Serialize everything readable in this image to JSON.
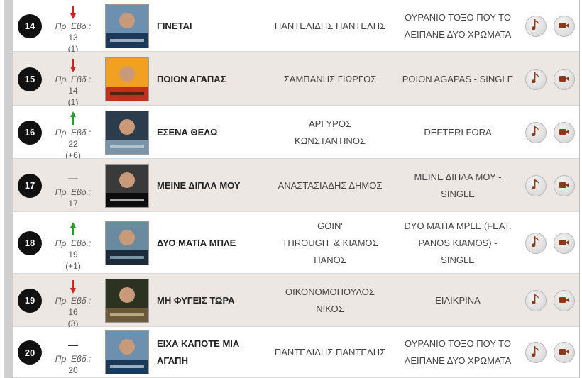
{
  "colors": {
    "up": "#2a9a2a",
    "down": "#d02020",
    "position_bg": "#111111",
    "row_alt": "#ede7e3",
    "action_icon": "#8a3a18"
  },
  "labels": {
    "prev_week": "Πρ. Εβδ.:",
    "same": "—"
  },
  "icons": {
    "listen": "music-note-icon",
    "video": "video-camera-icon"
  },
  "rows": [
    {
      "position": "14",
      "trend": "down",
      "prev_week": "13",
      "delta": "(1)",
      "title": [
        "ΓΙΝΕΤΑΙ"
      ],
      "artist": [
        "ΠΑΝΤΕΛΙΔΗΣ ΠΑΝΤΕΛΗΣ"
      ],
      "album": [
        "ΟΥΡΑΝΙΟ ΤΟΞΟ ΠΟΥ ΤΟ",
        "ΛΕΙΠΑΝΕ ΔΥΟ ΧΡΩΜΑΤΑ"
      ]
    },
    {
      "position": "15",
      "trend": "down",
      "prev_week": "14",
      "delta": "(1)",
      "title": [
        "ΠΟΙΟΝ ΑΓΑΠΑΣ"
      ],
      "artist": [
        "ΣΑΜΠΑΝΗΣ ΓΙΩΡΓΟΣ"
      ],
      "album": [
        "POION AGAPAS - SINGLE"
      ]
    },
    {
      "position": "16",
      "trend": "up",
      "prev_week": "22",
      "delta": "(+6)",
      "title": [
        "ΕΣΕΝΑ ΘΕΛΩ"
      ],
      "artist": [
        "ΑΡΓΥΡΟΣ",
        "ΚΩΝΣΤΑΝΤΙΝΟΣ"
      ],
      "album": [
        "DEFTERI FORA"
      ]
    },
    {
      "position": "17",
      "trend": "same",
      "prev_week": "17",
      "delta": "",
      "title": [
        "ΜΕΙΝΕ ΔΙΠΛΑ ΜΟΥ"
      ],
      "artist": [
        "ΑΝΑΣΤΑΣΙΑΔΗΣ ΔΗΜΟΣ"
      ],
      "album": [
        "ΜΕΙΝΕ ΔΙΠΛΑ ΜΟΥ -",
        "SINGLE"
      ]
    },
    {
      "position": "18",
      "trend": "up",
      "prev_week": "19",
      "delta": "(+1)",
      "title": [
        "ΔΥΟ ΜΑΤΙΑ ΜΠΛΕ"
      ],
      "artist": [
        "GOIN'",
        "THROUGH  & ΚΙΑΜΟΣ",
        "ΠΑΝΟΣ"
      ],
      "album": [
        "DYO MATIA MPLE (FEAT.",
        "PANOS KIAMOS) -",
        "SINGLE"
      ]
    },
    {
      "position": "19",
      "trend": "down",
      "prev_week": "16",
      "delta": "(3)",
      "title": [
        "ΜΗ ΦΥΓΕΙΣ ΤΩΡΑ"
      ],
      "artist": [
        "ΟΙΚΟΝΟΜΟΠΟΥΛΟΣ",
        "ΝΙΚΟΣ"
      ],
      "album": [
        "ΕΙΛΙΚΡΙΝΑ"
      ]
    },
    {
      "position": "20",
      "trend": "same",
      "prev_week": "20",
      "delta": "",
      "title": [
        "ΕΙΧΑ ΚΑΠΟΤΕ ΜΙΑ",
        "ΑΓΑΠΗ"
      ],
      "artist": [
        "ΠΑΝΤΕΛΙΔΗΣ ΠΑΝΤΕΛΗΣ"
      ],
      "album": [
        "ΟΥΡΑΝΙΟ ΤΟΞΟ ΠΟΥ ΤΟ",
        "ΛΕΙΠΑΝΕ ΔΥΟ ΧΡΩΜΑΤΑ"
      ]
    }
  ]
}
